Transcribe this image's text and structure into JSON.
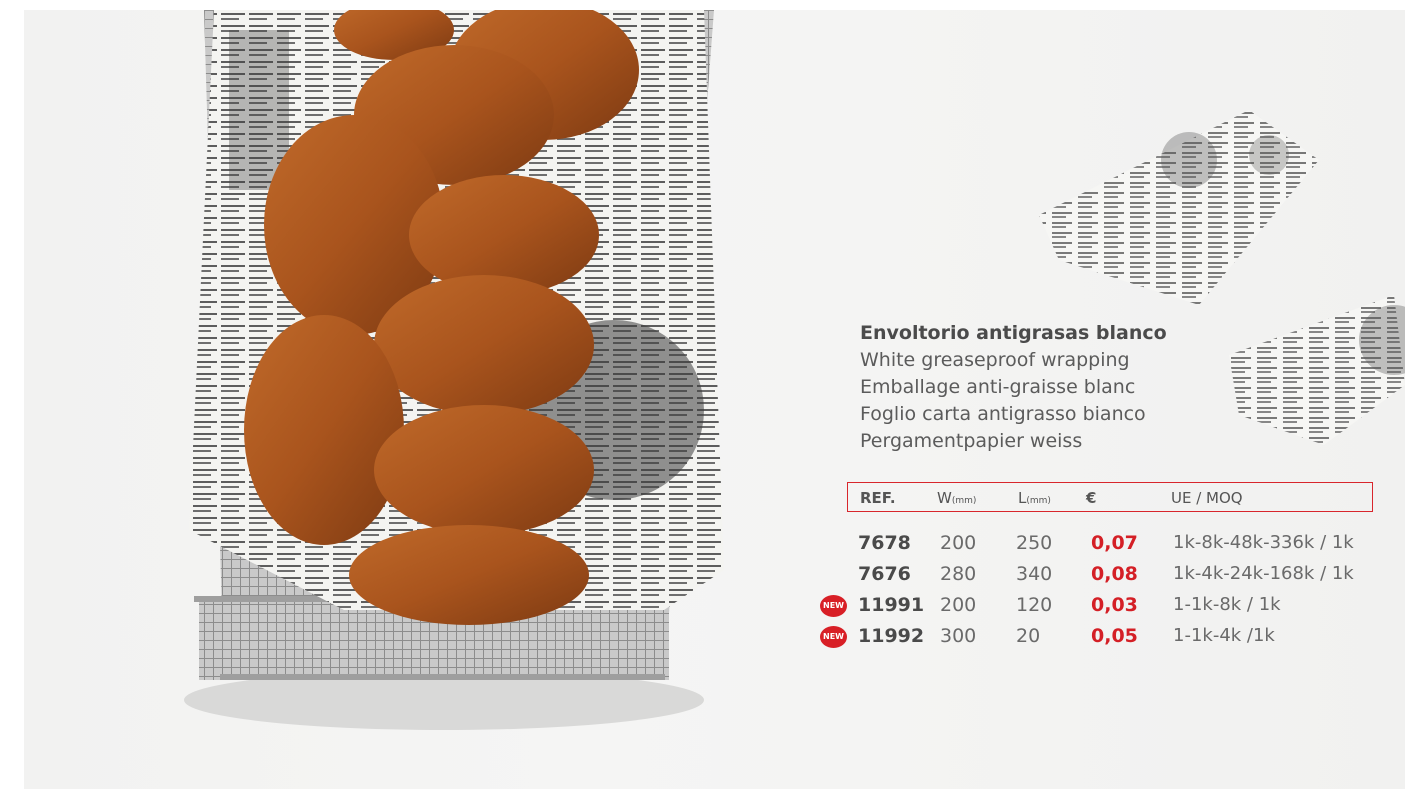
{
  "product": {
    "title_es": "Envoltorio antigrasas blanco",
    "title_en": "White greaseproof wrapping",
    "title_fr": "Emballage anti-graisse blanc",
    "title_it": "Foglio carta antigrasso bianco",
    "title_de": "Pergamentpapier weiss"
  },
  "table": {
    "headers": {
      "ref": "REF.",
      "w": "W",
      "w_unit": "(mm)",
      "l": "L",
      "l_unit": "(mm)",
      "price": "€",
      "moq": "UE  / MOQ"
    },
    "rows": [
      {
        "badge": "",
        "ref": "7678",
        "w": "200",
        "l": "250",
        "price": "0,07",
        "moq": "1k-8k-48k-336k / 1k"
      },
      {
        "badge": "",
        "ref": "7676",
        "w": "280",
        "l": "340",
        "price": "0,08",
        "moq": "1k-4k-24k-168k / 1k"
      },
      {
        "badge": "NEW",
        "ref": "11991",
        "w": "200",
        "l": "120",
        "price": "0,03",
        "moq": "1-1k-8k / 1k"
      },
      {
        "badge": "NEW",
        "ref": "11992",
        "w": "300",
        "l": "20",
        "price": "0,05",
        "moq": "1-1k-4k /1k"
      }
    ]
  },
  "colors": {
    "accent": "#d41f26",
    "text": "#5a5a5a",
    "background": "#f3f3f2"
  },
  "images": {
    "main_photo": "fried-nuggets-in-wire-basket-on-newspaper-print-paper",
    "wrapper_sample_1": "newspaper-print-greaseproof-sheet",
    "wrapper_sample_2": "newspaper-print-greaseproof-sheet"
  }
}
